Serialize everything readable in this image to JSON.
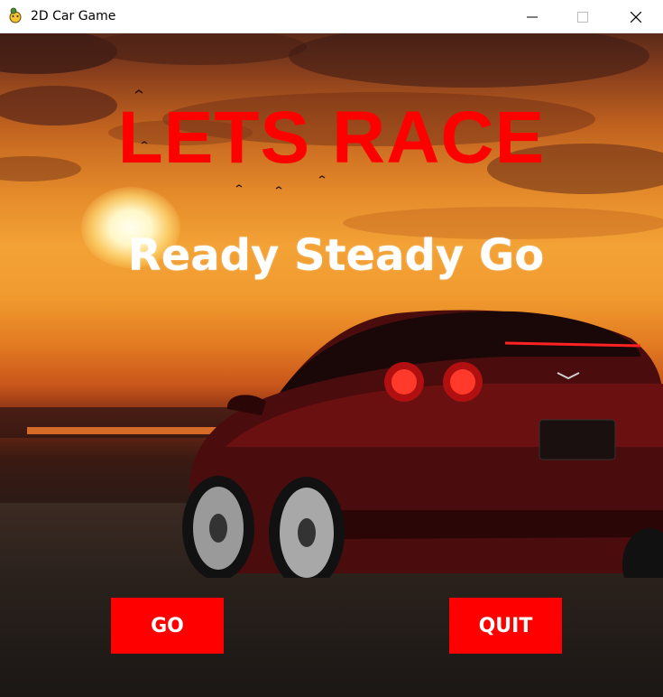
{
  "window": {
    "title": "2D Car Game",
    "icon": "pygame-snake-icon"
  },
  "game": {
    "title": "LETS RACE",
    "subtitle": "Ready Steady Go",
    "title_color": "#ff0000",
    "subtitle_color": "#ffffff"
  },
  "buttons": {
    "go_label": "GO",
    "quit_label": "QUIT",
    "color": "#ff0000"
  }
}
